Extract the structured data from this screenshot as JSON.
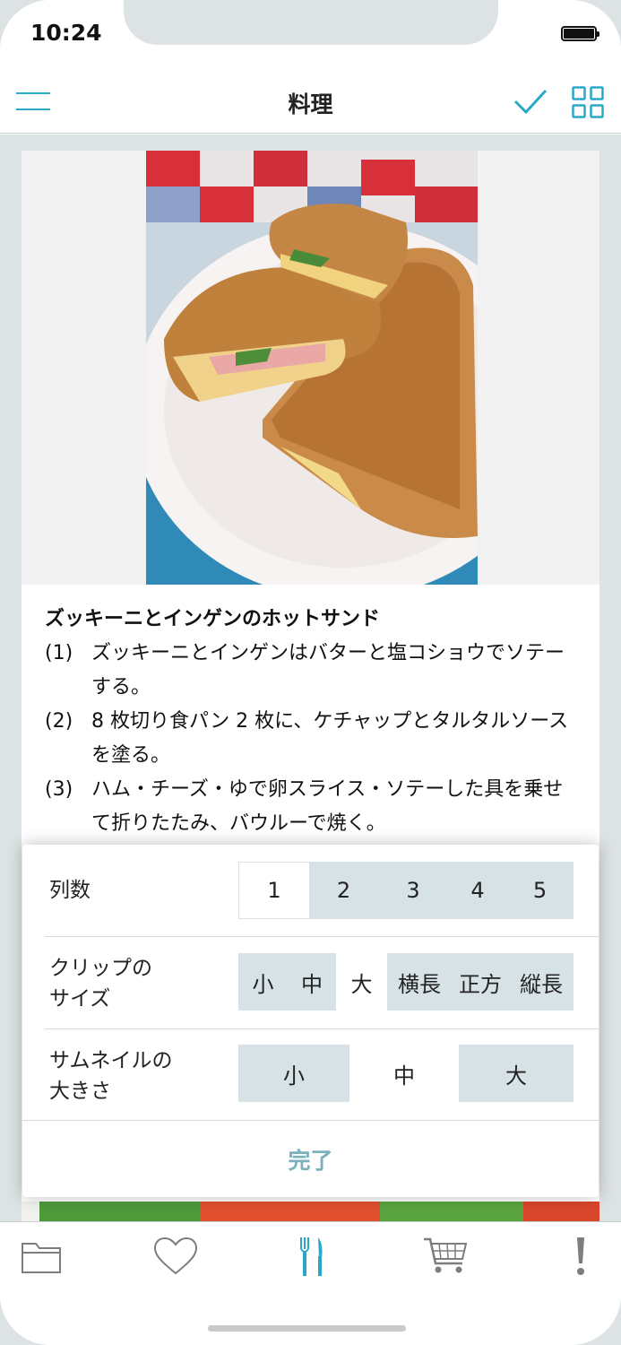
{
  "status": {
    "time": "10:24"
  },
  "header": {
    "title": "料理"
  },
  "recipe": {
    "title": "ズッキーニとインゲンのホットサンド",
    "steps": [
      {
        "num": "(1)",
        "text": "ズッキーニとインゲンはバターと塩コショウでソテーする。"
      },
      {
        "num": "(2)",
        "text": "8 枚切り食パン 2 枚に、ケチャップとタルタルソースを塗る。"
      },
      {
        "num": "(3)",
        "text": "ハム・チーズ・ゆで卵スライス・ソテーした具を乗せて折りたたみ、バウルーで焼く。"
      }
    ]
  },
  "settings": {
    "columns": {
      "label": "列数",
      "options": [
        "1",
        "2",
        "3",
        "4",
        "5"
      ],
      "selected": "1"
    },
    "clip_size": {
      "label_line1": "クリップの",
      "label_line2": "サイズ",
      "options": [
        "小",
        "中",
        "大",
        "横長",
        "正方",
        "縦長"
      ],
      "selected": "大"
    },
    "thumb_size": {
      "label_line1": "サムネイルの",
      "label_line2": "大きさ",
      "options": [
        "小",
        "中",
        "大"
      ],
      "selected": "中"
    },
    "done_label": "完了"
  },
  "colors": {
    "accent": "#2aa7c9",
    "segment_bg": "#d6e2e5",
    "done_text": "#7ab1bd"
  },
  "tabbar": {
    "items": [
      {
        "icon": "folder-icon"
      },
      {
        "icon": "heart-icon"
      },
      {
        "icon": "fork-knife-icon",
        "active": true
      },
      {
        "icon": "cart-icon"
      },
      {
        "icon": "exclamation-icon"
      }
    ]
  }
}
